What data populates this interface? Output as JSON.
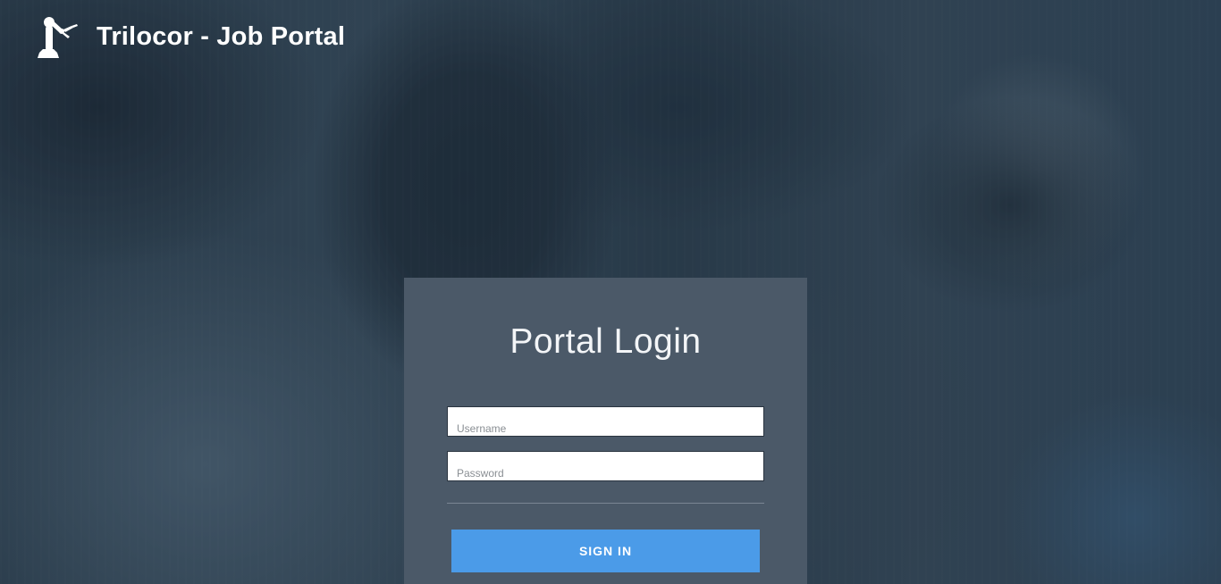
{
  "header": {
    "title": "Trilocor - Job Portal",
    "logo_icon": "robotic-arm-icon"
  },
  "login": {
    "title": "Portal Login",
    "username_placeholder": "Username",
    "password_placeholder": "Password",
    "submit_label": "SIGN IN"
  },
  "colors": {
    "card_background": "#4b5968",
    "button_accent": "#4b9be8",
    "text_light": "#ffffff"
  }
}
